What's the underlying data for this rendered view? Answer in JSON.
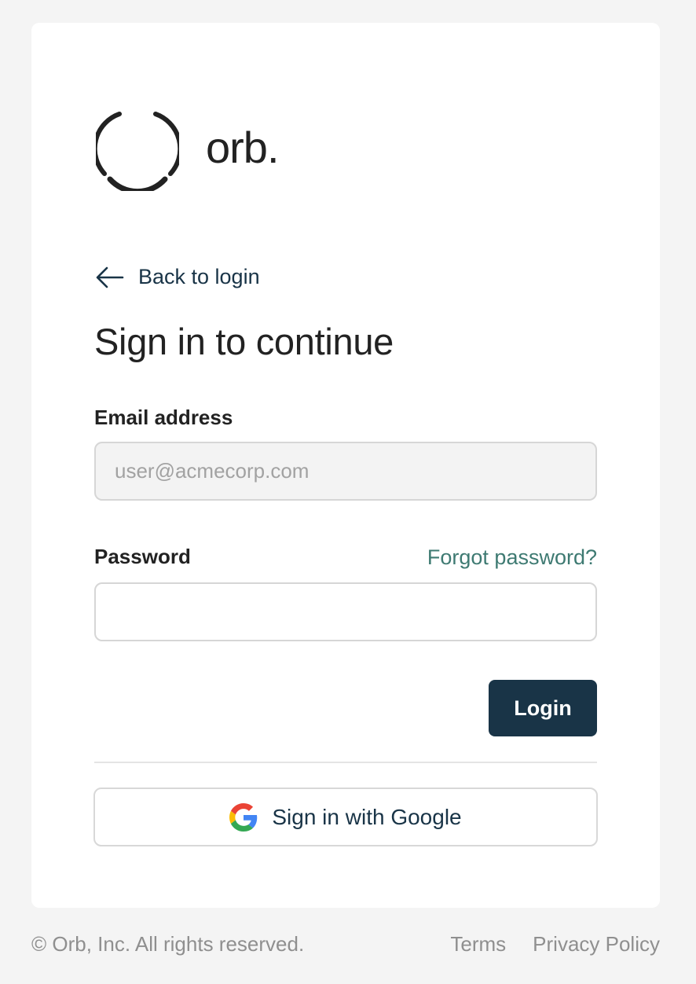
{
  "brand": {
    "name": "orb.",
    "logo_icon": "orb-logo-icon"
  },
  "nav": {
    "back_label": "Back to login",
    "back_icon": "arrow-left-icon"
  },
  "form": {
    "title": "Sign in to continue",
    "email_label": "Email address",
    "email_placeholder": "user@acmecorp.com",
    "email_value": "",
    "password_label": "Password",
    "password_value": "",
    "forgot_label": "Forgot password?",
    "login_label": "Login"
  },
  "sso": {
    "google_label": "Sign in with Google",
    "google_icon": "google-icon"
  },
  "footer": {
    "copyright": "© Orb, Inc. All rights reserved.",
    "terms": "Terms",
    "privacy": "Privacy Policy"
  },
  "colors": {
    "background": "#f4f4f4",
    "card": "#ffffff",
    "primary": "#193447",
    "link_accent": "#3e7a72",
    "muted_text": "#8f8f8f"
  }
}
